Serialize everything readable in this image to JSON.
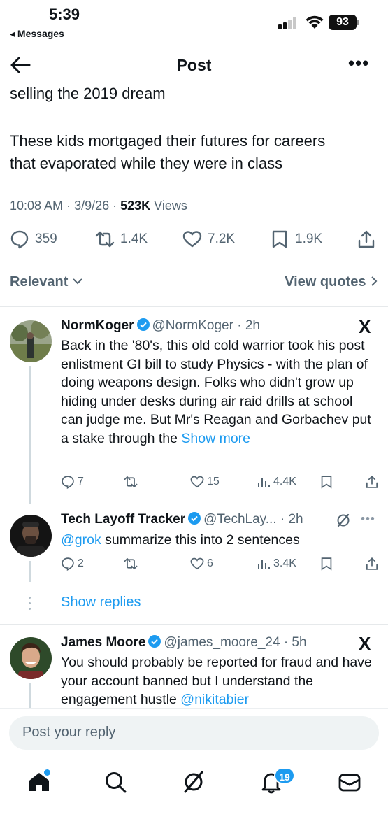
{
  "status_bar": {
    "time": "5:39",
    "back_app": "◂ Messages",
    "battery": "93"
  },
  "header": {
    "title": "Post",
    "more": "•••"
  },
  "post": {
    "lines": [
      "selling the 2019 dream",
      "These kids mortgaged their futures for careers",
      "that evaporated while they were in class"
    ],
    "time": "10:08 AM",
    "date": "3/9/26",
    "views_count": "523K",
    "views_label": "Views",
    "replies": "359",
    "reposts": "1.4K",
    "likes": "7.2K",
    "bookmarks": "1.9K"
  },
  "sort": {
    "left": "Relevant",
    "right": "View quotes"
  },
  "replies": [
    {
      "name": "NormKoger",
      "handle": "@NormKoger",
      "time": "· 2h",
      "text": "Back in the '80's, this old cold warrior took his post enlistment GI bill to study Physics - with the plan of doing weapons design. Folks who didn't grow up hiding under desks during air raid drills at school can judge me.  But Mr's Reagan and Gorbachev put a stake through the",
      "show_more": "Show more",
      "replies": "7",
      "reposts": "",
      "likes": "15",
      "views": "4.4K",
      "badge": "X"
    },
    {
      "name": "Tech Layoff Tracker",
      "handle": "@TechLay...",
      "time": "· 2h",
      "mention": "@grok",
      "text": " summarize this into 2 sentences",
      "replies": "2",
      "reposts": "",
      "likes": "6",
      "views": "3.4K",
      "more": "•••"
    },
    {
      "name": "James Moore",
      "handle": "@james_moore_24",
      "time": "· 5h",
      "text": "You should probably be reported for fraud and have your account banned but I understand the engagement hustle",
      "mention": "@nikitabier",
      "badge": "X"
    }
  ],
  "show_replies": "Show replies",
  "composer": {
    "placeholder": "Post your reply"
  },
  "tabbar": {
    "notifications_badge": "19"
  },
  "colors": {
    "accent": "#1d9bf0",
    "muted": "#536471",
    "text": "#0f1419"
  }
}
